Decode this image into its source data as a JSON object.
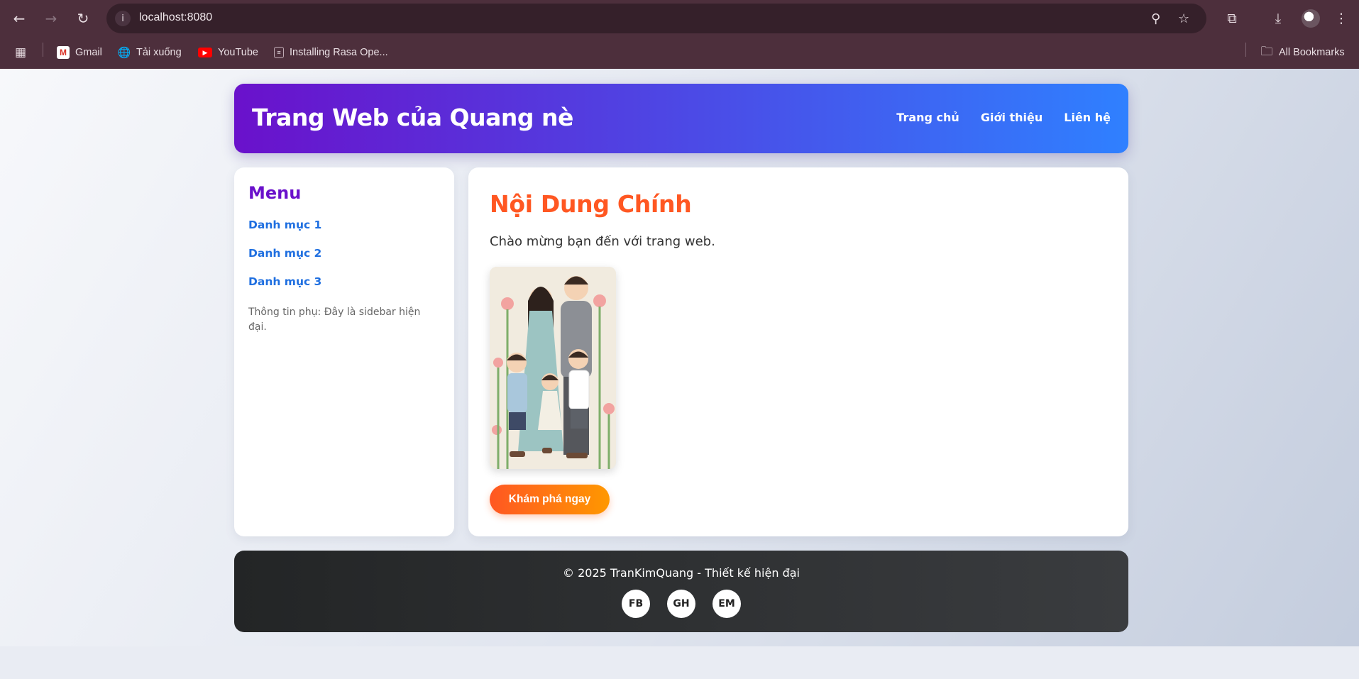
{
  "browser": {
    "url": "localhost:8080",
    "bookmarks": [
      {
        "label": "Gmail",
        "icon": "gmail-icon"
      },
      {
        "label": "Tải xuống",
        "icon": "globe-icon"
      },
      {
        "label": "YouTube",
        "icon": "youtube-icon"
      },
      {
        "label": "Installing Rasa Ope...",
        "icon": "page-icon"
      }
    ],
    "all_bookmarks": "All Bookmarks"
  },
  "header": {
    "title": "Trang Web của Quang nè",
    "nav": [
      "Trang chủ",
      "Giới thiệu",
      "Liên hệ"
    ]
  },
  "sidebar": {
    "heading": "Menu",
    "links": [
      "Danh mục 1",
      "Danh mục 2",
      "Danh mục 3"
    ],
    "note": "Thông tin phụ: Đây là sidebar hiện đại."
  },
  "main": {
    "heading": "Nội Dung Chính",
    "welcome": "Chào mừng bạn đến với trang web.",
    "cta": "Khám phá ngay"
  },
  "footer": {
    "copyright": "© 2025 TranKimQuang - Thiết kế hiện đại",
    "socials": [
      "FB",
      "GH",
      "EM"
    ]
  },
  "colors": {
    "header_gradient": [
      "#6a11cb",
      "#2f80ff"
    ],
    "accent": "#ff5722",
    "link": "#1f6fe0"
  }
}
